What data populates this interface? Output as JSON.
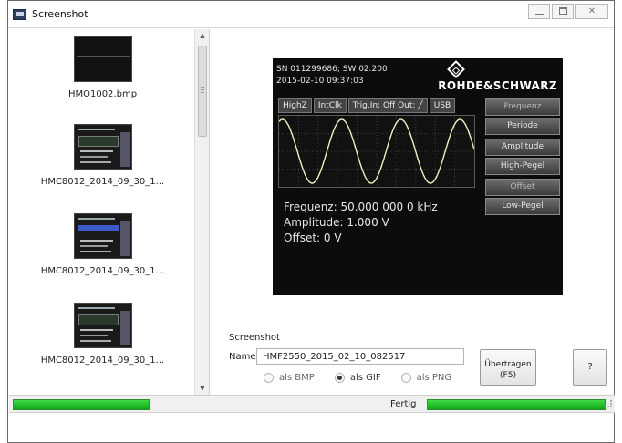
{
  "window": {
    "title": "Screenshot"
  },
  "file_list": [
    {
      "label": "HMO1002.bmp",
      "thumb": "black"
    },
    {
      "label": "HMC8012_2014_09_30_1...",
      "thumb": "screen"
    },
    {
      "label": "HMC8012_2014_09_30_1...",
      "thumb": "screen-blue"
    },
    {
      "label": "HMC8012_2014_09_30_1...",
      "thumb": "screen"
    }
  ],
  "preview": {
    "header_line1": "SN 011299686; SW 02.200",
    "header_line2": "2015-02-10    09:37:03",
    "brand": "ROHDE&SCHWARZ",
    "tabs": [
      "HighZ",
      "IntClk",
      "Trig.In: Off Out: ╱",
      "USB"
    ],
    "readout": {
      "frequency": "Frequenz: 50.000 000 0 kHz",
      "amplitude": "Amplitude: 1.000 V",
      "offset": "Offset: 0 V"
    },
    "softkeys": [
      {
        "label": "Frequenz",
        "dim": true
      },
      {
        "label": "Periode",
        "dim": false
      },
      {
        "label": "Amplitude",
        "dim": false
      },
      {
        "label": "High-Pegel",
        "dim": false
      },
      {
        "label": "Offset",
        "dim": true
      },
      {
        "label": "Low-Pegel",
        "dim": false
      }
    ],
    "colors": {
      "waveform": "#f2f0c0",
      "screen_bg": "#0c0c0c",
      "grid": "#3a3a3a"
    }
  },
  "form": {
    "title": "Screenshot",
    "name_label": "Name",
    "name_value": "HMF2550_2015_02_10_082517",
    "formats": [
      {
        "label": "als BMP",
        "checked": false
      },
      {
        "label": "als GIF",
        "checked": true
      },
      {
        "label": "als PNG",
        "checked": false
      }
    ],
    "transfer_button": {
      "line1": "Übertragen",
      "line2": "(F5)"
    },
    "help_button": "?"
  },
  "status": {
    "text": "Fertig",
    "left_progress": 1.0,
    "right_progress": 1.0,
    "progress_color": "#1fc22a"
  }
}
